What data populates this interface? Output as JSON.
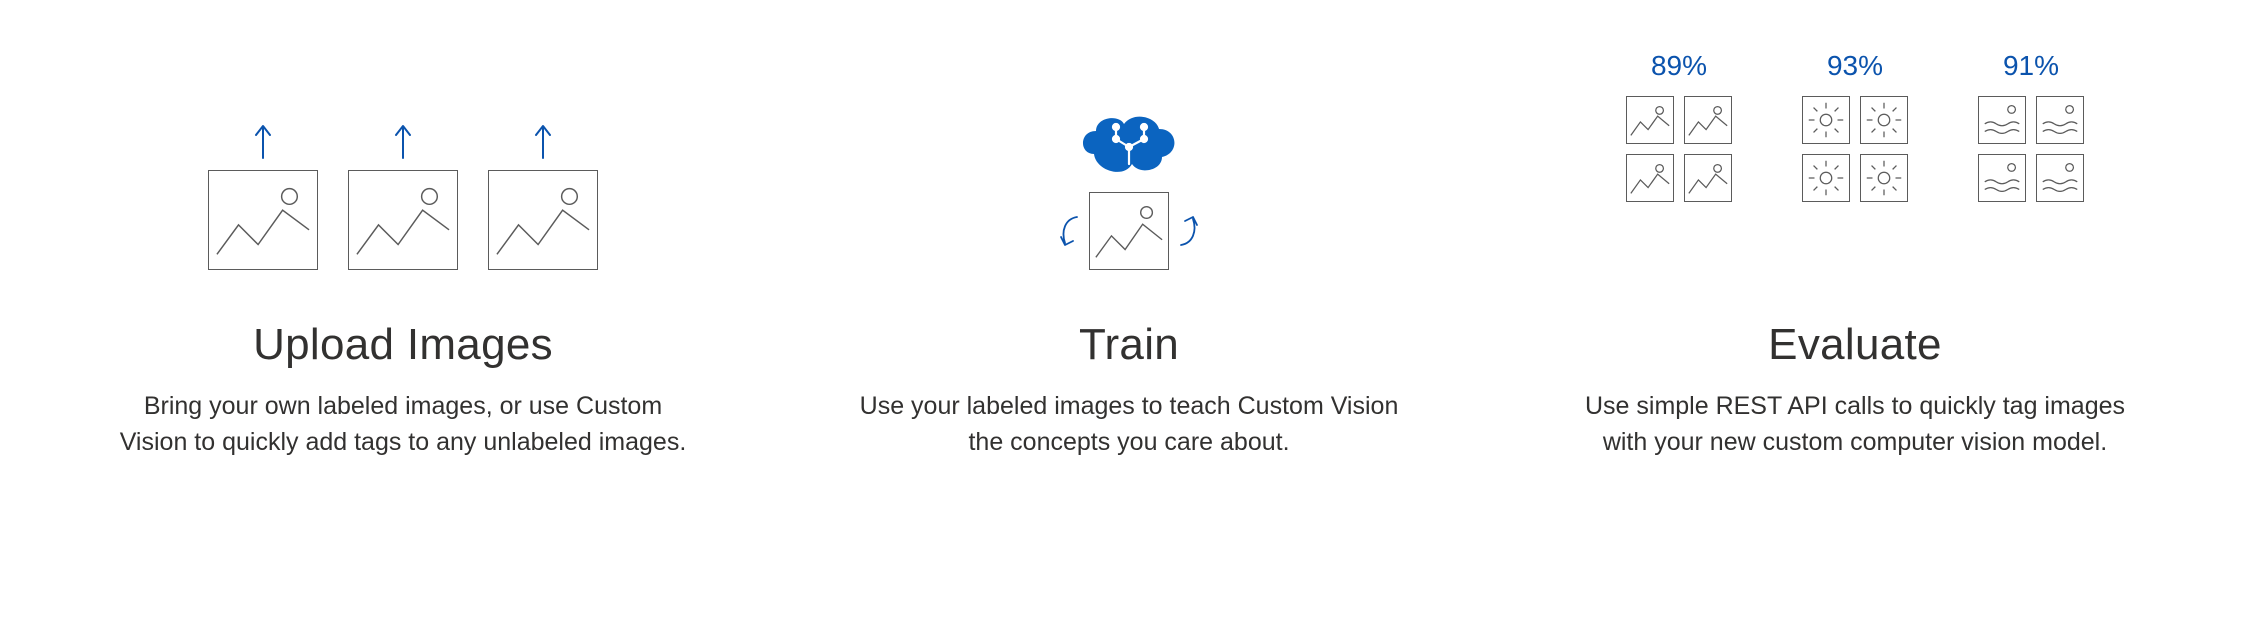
{
  "columns": [
    {
      "title": "Upload Images",
      "desc": "Bring your own labeled images, or use Custom Vision to quickly add tags to any unlabeled images."
    },
    {
      "title": "Train",
      "desc": "Use your labeled images to teach Custom Vision the concepts you care about."
    },
    {
      "title": "Evaluate",
      "desc": "Use simple REST API calls to quickly tag images with your new custom computer vision model."
    }
  ],
  "evaluate": {
    "groups": [
      {
        "percent": "89%"
      },
      {
        "percent": "93%"
      },
      {
        "percent": "91%"
      }
    ]
  },
  "colors": {
    "brand_blue": "#0b53ad",
    "line": "#5b5b5b"
  }
}
